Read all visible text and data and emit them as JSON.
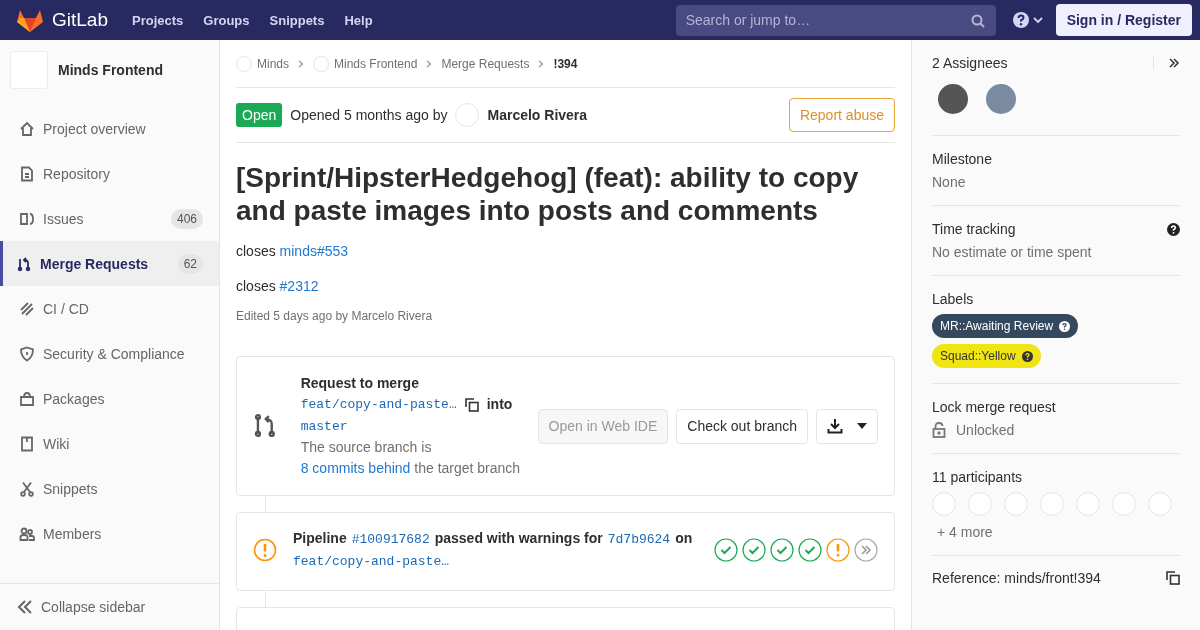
{
  "navbar": {
    "brand": "GitLab",
    "links": [
      "Projects",
      "Groups",
      "Snippets",
      "Help"
    ],
    "search": {
      "placeholder": "Search or jump to…"
    },
    "sign_in": "Sign in / Register"
  },
  "sidebar": {
    "project": "Minds Frontend",
    "items": [
      {
        "label": "Project overview",
        "selected": false
      },
      {
        "label": "Repository",
        "selected": false
      },
      {
        "label": "Issues",
        "count": "406",
        "selected": false
      },
      {
        "label": "Merge Requests",
        "count": "62",
        "selected": true
      },
      {
        "label": "CI / CD",
        "selected": false
      },
      {
        "label": "Security & Compliance",
        "selected": false
      },
      {
        "label": "Packages",
        "selected": false
      },
      {
        "label": "Wiki",
        "selected": false
      },
      {
        "label": "Snippets",
        "selected": false
      },
      {
        "label": "Members",
        "selected": false
      }
    ],
    "collapse": "Collapse sidebar"
  },
  "breadcrumbs": [
    {
      "label": "Minds",
      "avatar": true
    },
    {
      "label": "Minds Frontend",
      "avatar": true
    },
    {
      "label": "Merge Requests",
      "avatar": false
    },
    {
      "label": "!394",
      "avatar": false
    }
  ],
  "header": {
    "status": "Open",
    "opened": "Opened 5 months ago by",
    "author": "Marcelo Rivera",
    "report": "Report abuse"
  },
  "title": "[Sprint/HipsterHedgehog] (feat): ability to copy and paste images into posts and comments",
  "description": [
    {
      "text": "closes",
      "link": "minds#553"
    },
    {
      "text": "closes",
      "link": "#2312"
    }
  ],
  "edited": "Edited 5 days ago by Marcelo Rivera",
  "merge_box": {
    "title": "Request to merge",
    "source": "feat/copy-and-paste…",
    "into": "into",
    "target": "master",
    "behind_prefix": "The source branch is",
    "behind_link": "8 commits behind",
    "behind_suffix": "the target branch",
    "web_ide": "Open in Web IDE",
    "checkout": "Check out branch"
  },
  "pipeline": {
    "label": "Pipeline",
    "id": "#100917682",
    "status_text": "passed with warnings for",
    "sha": "7d7b9624",
    "on": "on",
    "branch": "feat/copy-and-paste…",
    "stages": [
      {
        "kind": "success"
      },
      {
        "kind": "success"
      },
      {
        "kind": "success"
      },
      {
        "kind": "success"
      },
      {
        "kind": "warning"
      },
      {
        "kind": "more"
      }
    ]
  },
  "right_sidebar": {
    "assignees": "2 Assignees",
    "milestone": {
      "label": "Milestone",
      "value": "None"
    },
    "time_tracking": {
      "label": "Time tracking",
      "value": "No estimate or time spent"
    },
    "labels": {
      "label": "Labels",
      "items": [
        {
          "text": "MR::Awaiting Review",
          "color": "#34495e"
        },
        {
          "text": "Squad::Yellow",
          "color": "#f0e413"
        }
      ]
    },
    "lock": {
      "label": "Lock merge request",
      "value": "Unlocked"
    },
    "participants": {
      "label": "11 participants",
      "more": "+ 4 more"
    },
    "reference": "Reference: minds/front!394"
  }
}
